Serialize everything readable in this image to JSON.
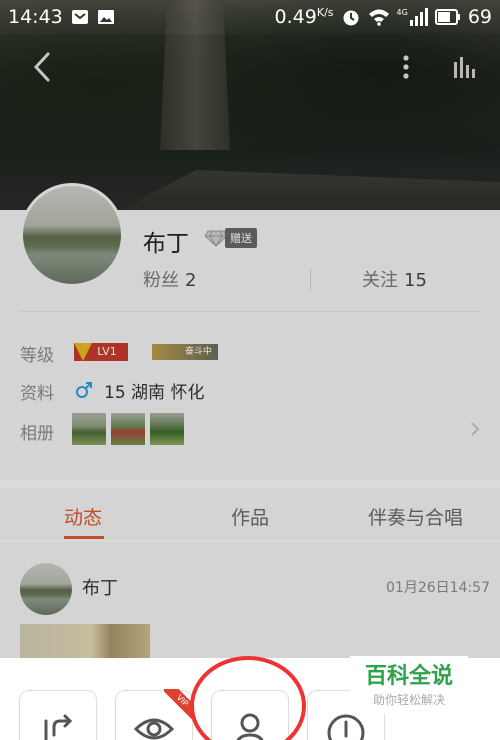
{
  "status_bar": {
    "time": "14:43",
    "speed": "0.49",
    "speed_unit": "K/s",
    "network": "4G",
    "battery": "69"
  },
  "profile": {
    "username": "布丁",
    "gift_label": "赠送",
    "fans_label": "粉丝",
    "fans_count": "2",
    "following_label": "关注",
    "following_count": "15",
    "level_label": "等级",
    "level_badge": "LV1",
    "fight_badge": "奋斗中",
    "info_label": "资料",
    "info_value": "15  湖南 怀化",
    "album_label": "相册"
  },
  "tabs": [
    {
      "label": "动态",
      "active": true
    },
    {
      "label": "作品",
      "active": false
    },
    {
      "label": "伴奏与合唱",
      "active": false
    }
  ],
  "feed": {
    "name": "布丁",
    "time": "01月26日14:57"
  },
  "sheet": {
    "vip_tag": "VIP"
  },
  "watermark": {
    "title": "百科全说",
    "subtitle": "助你轻松解决"
  },
  "colors": {
    "accent": "#d35a2e",
    "highlight_ring": "#e33333",
    "watermark_green": "#2fa24a"
  }
}
